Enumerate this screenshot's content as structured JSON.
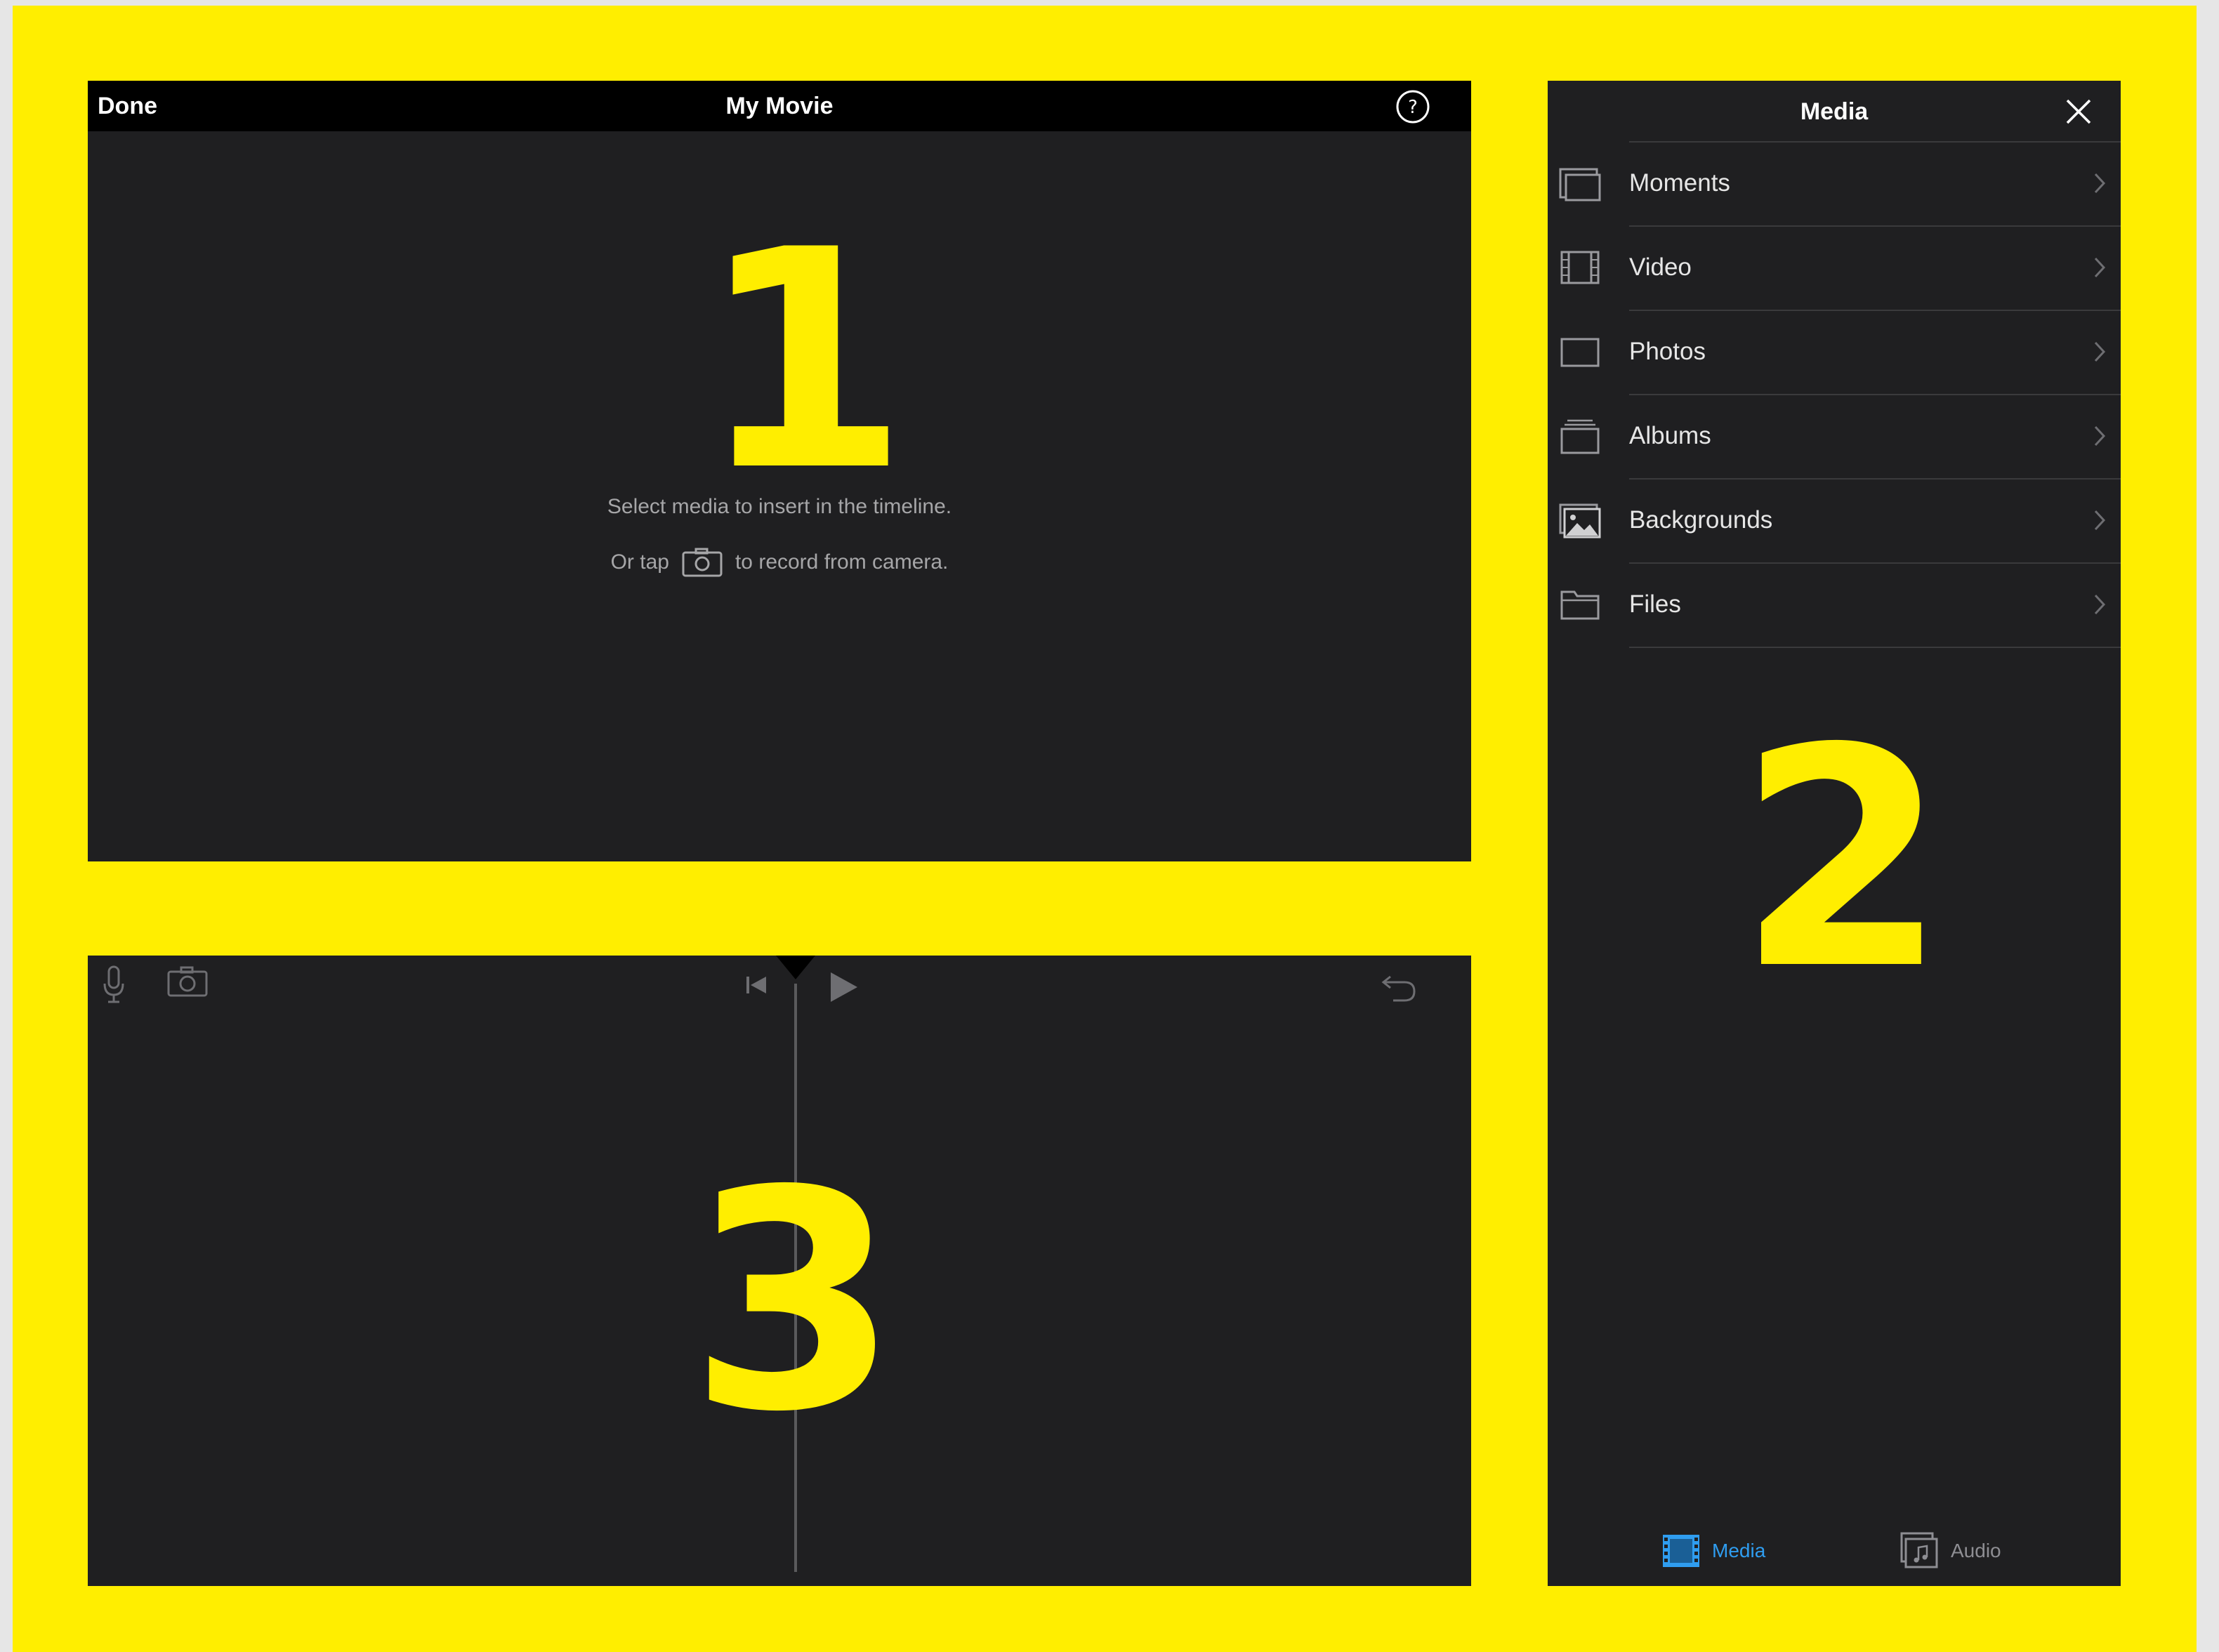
{
  "viewer": {
    "done_label": "Done",
    "title": "My Movie",
    "help_icon": "question-circle-icon",
    "message_line1": "Select media to insert in the timeline.",
    "message_line2_prefix": "Or tap",
    "message_line2_suffix": "to record from camera.",
    "camera_icon": "camera-icon"
  },
  "media_panel": {
    "title": "Media",
    "close_icon": "close-x-icon",
    "items": [
      {
        "label": "Moments",
        "icon": "moments-icon"
      },
      {
        "label": "Video",
        "icon": "film-icon"
      },
      {
        "label": "Photos",
        "icon": "photo-frame-icon"
      },
      {
        "label": "Albums",
        "icon": "albums-icon"
      },
      {
        "label": "Backgrounds",
        "icon": "landscape-image-icon"
      },
      {
        "label": "Files",
        "icon": "folder-icon"
      }
    ],
    "tabs": [
      {
        "label": "Media",
        "icon": "film-strip-icon",
        "active": true
      },
      {
        "label": "Audio",
        "icon": "music-note-icon",
        "active": false
      }
    ]
  },
  "timeline": {
    "icons": [
      "microphone-icon",
      "camera-icon",
      "skip-to-start-icon",
      "play-icon",
      "undo-icon"
    ]
  },
  "overlay_numbers": [
    "1",
    "2",
    "3"
  ],
  "colors": {
    "frame_yellow": "#ffee00",
    "panel_bg": "#1f1f21",
    "topbar_bg": "#000000",
    "accent_blue": "#2f9df0"
  }
}
